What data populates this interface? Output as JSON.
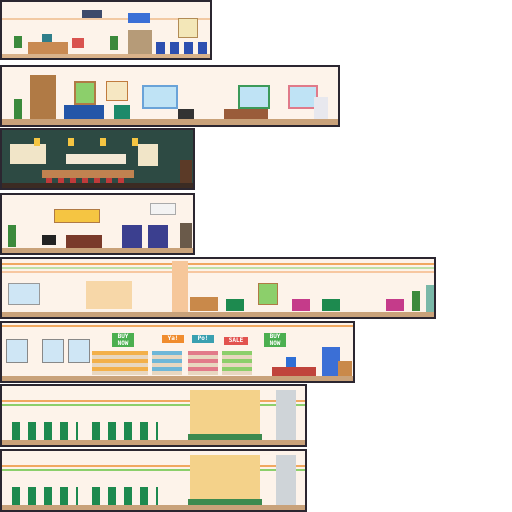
{
  "scene": "pixel-art room tileset",
  "rooms": [
    {
      "id": "lobby",
      "kind": "clinic reception"
    },
    {
      "id": "living-room",
      "kind": "apartment living room"
    },
    {
      "id": "sushi-bar",
      "kind": "restaurant counter"
    },
    {
      "id": "arcade-lounge",
      "kind": "lounge with arcade machines"
    },
    {
      "id": "bakery-lounge",
      "kind": "bakery and seating"
    },
    {
      "id": "convenience-store",
      "kind": "shop aisles"
    },
    {
      "id": "food-court-1",
      "kind": "food court"
    },
    {
      "id": "food-court-2",
      "kind": "food court"
    }
  ],
  "signs": {
    "buy_now_1": "BUY NOW",
    "buy_now_2": "BUY NOW",
    "sale": "SALE",
    "ya": "Ya!",
    "po": "Po!"
  },
  "colors": {
    "frame": "#2b2630",
    "wall_cream": "#fbf1e6",
    "floor_wood": "#c9a27a",
    "sushi_wall": "#2d4a43",
    "sofa_blue": "#2456a8",
    "chair_green": "#1d8a4f",
    "chair_pink": "#c53b8a",
    "sign_green": "#4caf50",
    "sign_orange": "#f08c2e"
  }
}
